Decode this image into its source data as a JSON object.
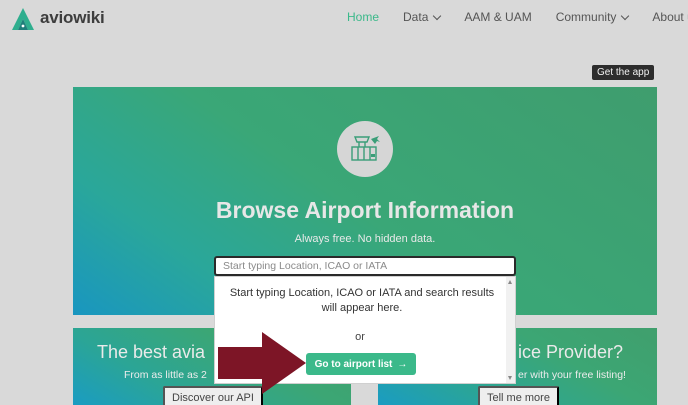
{
  "header": {
    "brand": "aviowiki",
    "nav": [
      {
        "label": "Home",
        "active": true,
        "dropdown": false
      },
      {
        "label": "Data",
        "active": false,
        "dropdown": true
      },
      {
        "label": "AAM & UAM",
        "active": false,
        "dropdown": false
      },
      {
        "label": "Community",
        "active": false,
        "dropdown": true
      },
      {
        "label": "About u",
        "active": false,
        "dropdown": false
      }
    ]
  },
  "get_app_label": "Get the app",
  "hero": {
    "icon": "airport-tower-icon",
    "title": "Browse Airport Information",
    "subtitle": "Always free. No hidden data."
  },
  "search": {
    "value": "",
    "placeholder": "Start typing Location, ICAO or IATA"
  },
  "dropdown": {
    "message": "Start typing Location, ICAO or IATA and search results will appear here.",
    "or_label": "or",
    "button_label": "Go to airport list",
    "button_icon": "arrow-right-icon"
  },
  "cards": {
    "left": {
      "title": "The best avia",
      "text": "From as little as 2",
      "button_label": "Discover our API"
    },
    "right": {
      "title": "ice Provider?",
      "text": "er with your free listing!",
      "button_label": "Tell me more"
    }
  },
  "colors": {
    "accent": "#3bb98a",
    "annotation_arrow": "#7d1526"
  }
}
